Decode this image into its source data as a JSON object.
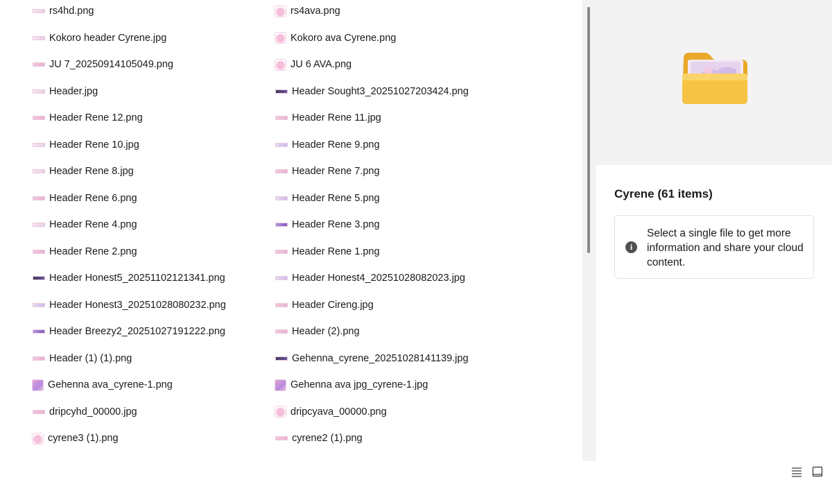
{
  "files": [
    {
      "name": "rs4hd.png",
      "thumb": "banner"
    },
    {
      "name": "rs4ava.png",
      "thumb": "avatar"
    },
    {
      "name": "Kokoro header Cyrene.jpg",
      "thumb": "banner"
    },
    {
      "name": "Kokoro ava Cyrene.png",
      "thumb": "avatar"
    },
    {
      "name": "JU 7_20250914105049.png",
      "thumb": "banner pink"
    },
    {
      "name": "JU 6 AVA.png",
      "thumb": "avatar"
    },
    {
      "name": "Header.jpg",
      "thumb": "banner"
    },
    {
      "name": "Header Sought3_20251027203424.png",
      "thumb": "banner dark"
    },
    {
      "name": "Header Rene 12.png",
      "thumb": "banner pink"
    },
    {
      "name": "Header Rene 11.jpg",
      "thumb": "banner pink"
    },
    {
      "name": "Header Rene 10.jpg",
      "thumb": "banner"
    },
    {
      "name": "Header Rene 9.png",
      "thumb": "banner lav"
    },
    {
      "name": "Header Rene 8.jpg",
      "thumb": "banner"
    },
    {
      "name": "Header Rene 7.png",
      "thumb": "banner pink"
    },
    {
      "name": "Header Rene 6.png",
      "thumb": "banner pink"
    },
    {
      "name": "Header Rene 5.png",
      "thumb": "banner lav"
    },
    {
      "name": "Header Rene 4.png",
      "thumb": "banner"
    },
    {
      "name": "Header Rene 3.png",
      "thumb": "banner purple"
    },
    {
      "name": "Header Rene 2.png",
      "thumb": "banner pink"
    },
    {
      "name": "Header Rene 1.png",
      "thumb": "banner pink"
    },
    {
      "name": "Header Honest5_20251102121341.png",
      "thumb": "banner dark"
    },
    {
      "name": "Header Honest4_20251028082023.jpg",
      "thumb": "banner lav"
    },
    {
      "name": "Header Honest3_20251028080232.png",
      "thumb": "banner lav"
    },
    {
      "name": "Header Cireng.jpg",
      "thumb": "banner pink"
    },
    {
      "name": "Header Breezy2_20251027191222.png",
      "thumb": "banner purple"
    },
    {
      "name": "Header (2).png",
      "thumb": "banner pink"
    },
    {
      "name": "Header (1) (1).png",
      "thumb": "banner pink"
    },
    {
      "name": "Gehenna_cyrene_20251028141139.jpg",
      "thumb": "banner dark"
    },
    {
      "name": "Gehenna ava_cyrene-1.png",
      "thumb": "avatar sq"
    },
    {
      "name": "Gehenna ava jpg_cyrene-1.jpg",
      "thumb": "avatar sq"
    },
    {
      "name": "dripcyhd_00000.jpg",
      "thumb": "banner pink"
    },
    {
      "name": "dripcyava_00000.png",
      "thumb": "avatar"
    },
    {
      "name": "cyrene3 (1).png",
      "thumb": "avatar"
    },
    {
      "name": "cyrene2 (1).png",
      "thumb": "banner pink"
    }
  ],
  "details": {
    "title": "Cyrene (61 items)",
    "info_text": "Select a single file to get more information and share your cloud content.",
    "info_icon_glyph": "i"
  },
  "status_bar": {
    "details_view_icon": "details-view-icon",
    "tiles_view_icon": "tiles-view-icon"
  },
  "colors": {
    "preview_bg": "#f3f3f3",
    "folder_yellow": "#f6c344",
    "accent_text": "#1a1a1a"
  }
}
